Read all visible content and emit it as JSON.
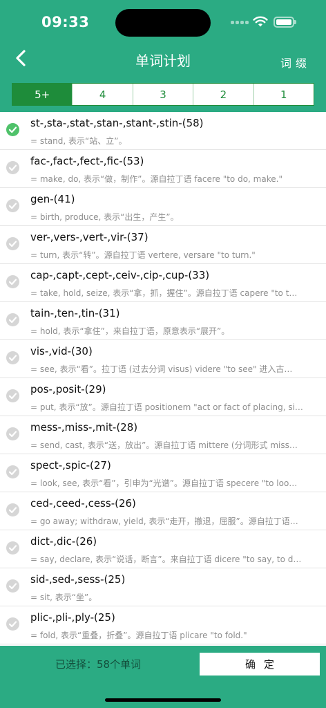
{
  "status": {
    "time": "09:33"
  },
  "nav": {
    "title": "单词计划",
    "right_label": "词缀"
  },
  "tabs": [
    {
      "label": "5+",
      "active": true
    },
    {
      "label": "4",
      "active": false
    },
    {
      "label": "3",
      "active": false
    },
    {
      "label": "2",
      "active": false
    },
    {
      "label": "1",
      "active": false
    }
  ],
  "items": [
    {
      "root": "st-,sta-,stat-,stan-,stant-,stin-(58)",
      "desc": "= stand, 表示“站、立”。",
      "selected": true
    },
    {
      "root": "fac-,fact-,fect-,fic-(53)",
      "desc": "= make, do, 表示“做，制作”。源自拉丁语 facere \"to do, make.\"",
      "selected": false
    },
    {
      "root": "gen-(41)",
      "desc": "= birth, produce, 表示“出生，产生”。",
      "selected": false
    },
    {
      "root": "ver-,vers-,vert-,vir-(37)",
      "desc": "= turn, 表示“转”。源自拉丁语 vertere, versare \"to turn.\"",
      "selected": false
    },
    {
      "root": "cap-,capt-,cept-,ceiv-,cip-,cup-(33)",
      "desc": "= take, hold, seize, 表示“拿，抓，握住”。源自拉丁语 capere \"to t…",
      "selected": false
    },
    {
      "root": "tain-,ten-,tin-(31)",
      "desc": "= hold, 表示“拿住”，来自拉丁语，原意表示“展开”。",
      "selected": false
    },
    {
      "root": "vis-,vid-(30)",
      "desc": "= see, 表示“看”。拉丁语 (过去分词 visus) videre \"to see\" 进入古…",
      "selected": false
    },
    {
      "root": "pos-,posit-(29)",
      "desc": "= put, 表示“放”。源自拉丁语 positionem \"act or fact of placing, si…",
      "selected": false
    },
    {
      "root": "mess-,miss-,mit-(28)",
      "desc": "= send, cast, 表示“送，放出”。源自拉丁语 mittere (分词形式 miss…",
      "selected": false
    },
    {
      "root": "spect-,spic-(27)",
      "desc": "= look, see, 表示“看”，引申为“光谱”。源自拉丁语 specere \"to loo…",
      "selected": false
    },
    {
      "root": "ced-,ceed-,cess-(26)",
      "desc": "= go away; withdraw, yield, 表示“走开，撤退，屈服”。源自拉丁语…",
      "selected": false
    },
    {
      "root": "dict-,dic-(26)",
      "desc": "= say, declare, 表示“说话，断言”。来自拉丁语 dicere \"to say, to d…",
      "selected": false
    },
    {
      "root": "sid-,sed-,sess-(25)",
      "desc": "= sit, 表示“坐”。",
      "selected": false
    },
    {
      "root": "plic-,pli-,ply-(25)",
      "desc": "= fold, 表示“重叠，折叠”。源自拉丁语 plicare \"to fold.\"",
      "selected": false
    }
  ],
  "footer": {
    "selected_text": "已选择：58个单词",
    "confirm_label": "确定"
  },
  "colors": {
    "primary": "#2bab83",
    "tab_green": "#1e8c3a",
    "check_on": "#4fc26a",
    "check_off": "#d6d6d6"
  }
}
